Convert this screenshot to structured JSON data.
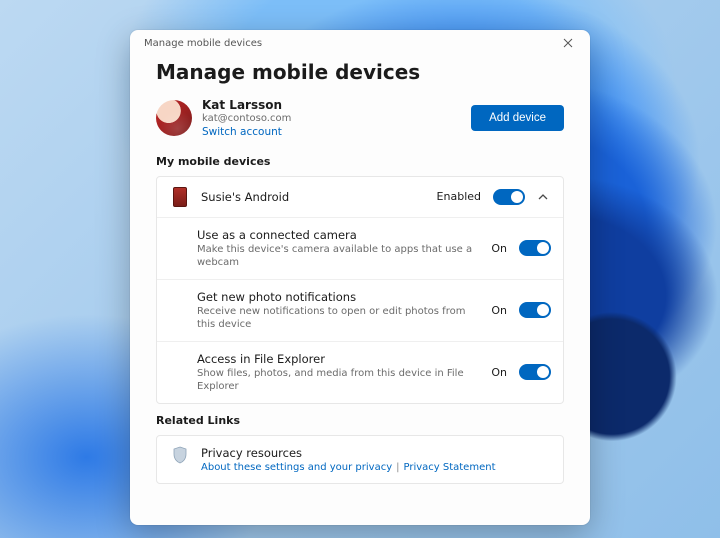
{
  "window": {
    "title": "Manage mobile devices"
  },
  "header": {
    "h1": "Manage mobile devices"
  },
  "account": {
    "name": "Kat Larsson",
    "email": "kat@contoso.com",
    "switch_label": "Switch account",
    "add_button": "Add device"
  },
  "devices": {
    "section_label": "My mobile devices",
    "item": {
      "name": "Susie's Android",
      "state": "Enabled"
    },
    "settings": [
      {
        "title": "Use as a connected camera",
        "desc": "Make this device's camera available to apps that use a webcam",
        "state": "On"
      },
      {
        "title": "Get new photo notifications",
        "desc": "Receive new notifications to open or edit photos from this device",
        "state": "On"
      },
      {
        "title": "Access in File Explorer",
        "desc": "Show files, photos, and media from this device in File Explorer",
        "state": "On"
      }
    ]
  },
  "related": {
    "section_label": "Related Links",
    "title": "Privacy resources",
    "link1": "About these settings and your privacy",
    "link2": "Privacy Statement"
  }
}
